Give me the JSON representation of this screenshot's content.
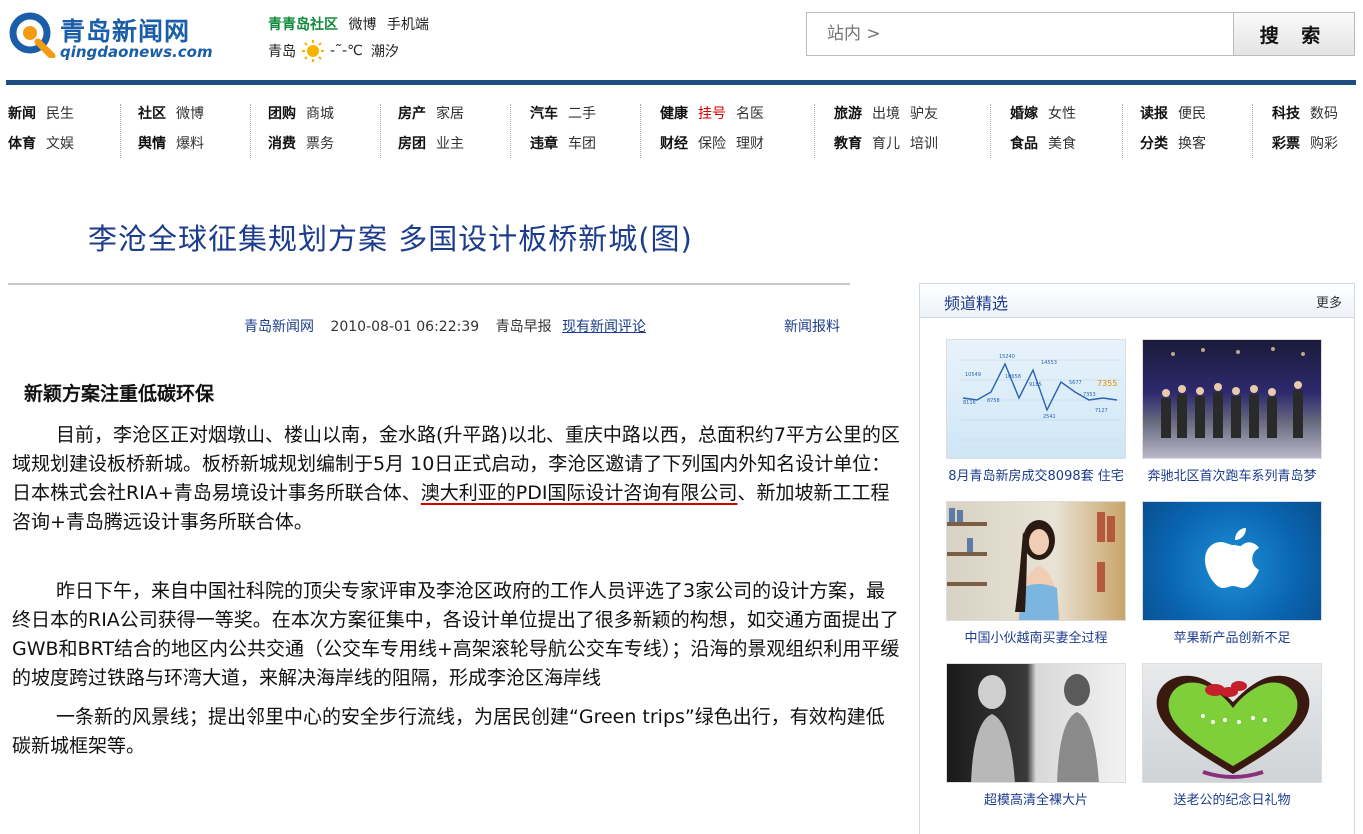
{
  "logo": {
    "cn": "青岛新闻网",
    "en": "qingdaonews.com"
  },
  "toplinks": [
    "青青岛社区",
    "微博",
    "手机端"
  ],
  "weather": {
    "city": "青岛",
    "temp": "-˜-℃",
    "tide": "潮汐"
  },
  "search": {
    "placeholder": "站内 >",
    "button": "搜 索"
  },
  "nav": [
    {
      "r1": [
        "新闻",
        "民生"
      ],
      "r2": [
        "体育",
        "文娱"
      ]
    },
    {
      "r1": [
        "社区",
        "微博"
      ],
      "r2": [
        "舆情",
        "爆料"
      ]
    },
    {
      "r1": [
        "团购",
        "商城"
      ],
      "r2": [
        "消费",
        "票务"
      ]
    },
    {
      "r1": [
        "房产",
        "家居"
      ],
      "r2": [
        "房团",
        "业主"
      ]
    },
    {
      "r1": [
        "汽车",
        "二手"
      ],
      "r2": [
        "违章",
        "车团"
      ]
    },
    {
      "r1": [
        "健康",
        "挂号",
        "名医"
      ],
      "r2": [
        "财经",
        "保险",
        "理财"
      ]
    },
    {
      "r1": [
        "旅游",
        "出境",
        "驴友"
      ],
      "r2": [
        "教育",
        "育儿",
        "培训"
      ]
    },
    {
      "r1": [
        "婚嫁",
        "女性"
      ],
      "r2": [
        "食品",
        "美食"
      ]
    },
    {
      "r1": [
        "读报",
        "便民"
      ],
      "r2": [
        "分类",
        "换客"
      ]
    },
    {
      "r1": [
        "科技",
        "数码"
      ],
      "r2": [
        "彩票",
        "购彩"
      ]
    }
  ],
  "article": {
    "title": "李沧全球征集规划方案 多国设计板桥新城(图)",
    "source": "青岛新闻网",
    "datetime": "2010-08-01 06:22:39",
    "origin": "青岛早报",
    "comments": "现有新闻评论",
    "report": "新闻报料",
    "subheading": "新颖方案注重低碳环保",
    "p1a": "目前，李沧区正对烟墩山、楼山以南，金水路(升平路)以北、重庆中路以西，总面积约7平方公里的区域规划建设板桥新城。板桥新城规划编制于5月 10日正式启动，李沧区邀请了下列国内外知名设计单位：日本株式会社RIA+青岛易境设计事务所联合体、",
    "p1b": "澳大利亚的PDI国际设计咨询有限公司",
    "p1c": "、新加坡新工工程咨询+青岛腾远设计事务所联合体。",
    "p2": "昨日下午，来自中国社科院的顶尖专家评审及李沧区政府的工作人员评选了3家公司的设计方案，最终日本的RIA公司获得一等奖。在本次方案征集中，各设计单位提出了很多新颖的构想，如交通方面提出了GWB和BRT结合的地区内公共交通（公交车专用线+高架滚轮导航公交车专线）；沿海的景观组织利用平缓的坡度跨过铁路与环湾大道，来解决海岸线的阻隔，形成李沧区海岸线",
    "p3": "一条新的风景线；提出邻里中心的安全步行流线，为居民创建“Green trips”绿色出行，有效构建低碳新城框架等。"
  },
  "sidebar": {
    "title": "频道精选",
    "more": "更多",
    "items": [
      {
        "caption": "8月青岛新房成交8098套 住宅"
      },
      {
        "caption": "奔驰北区首次跑车系列青岛梦"
      },
      {
        "caption": "中国小伙越南买妻全过程"
      },
      {
        "caption": "苹果新产品创新不足"
      },
      {
        "caption": "超模高清全裸大片"
      },
      {
        "caption": "送老公的纪念日礼物"
      }
    ],
    "chart_values": [
      "10549",
      "15240",
      "14553",
      "8116",
      "8758",
      "10658",
      "9185",
      "5677",
      "2541",
      "7355",
      "7353",
      "7127"
    ]
  },
  "colors": {
    "brand": "#1a5ea8",
    "topbar": "#1e4d83",
    "title": "#1c3c8c",
    "red": "#d10000"
  }
}
